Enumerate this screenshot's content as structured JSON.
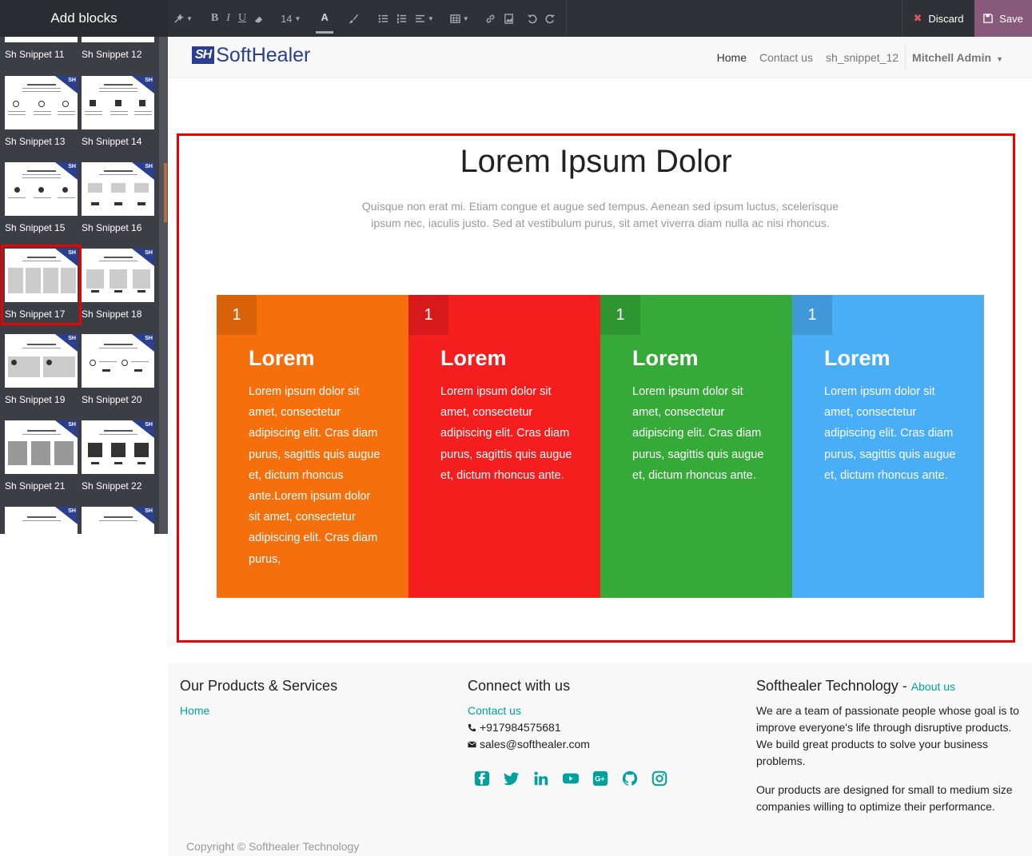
{
  "editor": {
    "panel_title": "Add blocks",
    "font_size": "14",
    "discard_label": "Discard",
    "save_label": "Save",
    "colors": {
      "bar": "#2f3136",
      "save": "#875a7b",
      "discard_icon": "#e0555c"
    }
  },
  "snippets": [
    {
      "label": "Sh Snippet 11"
    },
    {
      "label": "Sh Snippet 12"
    },
    {
      "label": "Sh Snippet 13"
    },
    {
      "label": "Sh Snippet 14"
    },
    {
      "label": "Sh Snippet 15"
    },
    {
      "label": "Sh Snippet 16"
    },
    {
      "label": "Sh Snippet 17"
    },
    {
      "label": "Sh Snippet 18"
    },
    {
      "label": "Sh Snippet 19"
    },
    {
      "label": "Sh Snippet 20"
    },
    {
      "label": "Sh Snippet 21"
    },
    {
      "label": "Sh Snippet 22"
    }
  ],
  "site": {
    "brand_icon": "SH",
    "brand_text": "SoftHealer",
    "nav": {
      "home": "Home",
      "contact": "Contact us",
      "snippet": "sh_snippet_12",
      "user": "Mitchell Admin"
    }
  },
  "section": {
    "title": "Lorem Ipsum Dolor",
    "subtitle": "Quisque non erat mi. Etiam congue et augue sed tempus. Aenean sed ipsum luctus, scelerisque ipsum nec, iaculis justo. Sed at vestibulum purus, sit amet viverra diam nulla ac nisi rhoncus.",
    "cards": [
      {
        "num": "1",
        "title": "Lorem",
        "text": "Lorem ipsum dolor sit amet, consectetur adipiscing elit. Cras diam purus, sagittis quis augue et, dictum rhoncus ante.Lorem ipsum dolor sit amet, consectetur adipiscing elit. Cras diam purus,",
        "color": "#f5700c"
      },
      {
        "num": "1",
        "title": "Lorem",
        "text": "Lorem ipsum dolor sit amet, consectetur adipiscing elit. Cras diam purus, sagittis quis augue et, dictum rhoncus ante.",
        "color": "#f41e1f"
      },
      {
        "num": "1",
        "title": "Lorem",
        "text": "Lorem ipsum dolor sit amet, consectetur adipiscing elit. Cras diam purus, sagittis quis augue et, dictum rhoncus ante.",
        "color": "#35aa38"
      },
      {
        "num": "1",
        "title": "Lorem",
        "text": "Lorem ipsum dolor sit amet, consectetur adipiscing elit. Cras diam purus, sagittis quis augue et, dictum rhoncus ante.",
        "color": "#4aaef7"
      }
    ]
  },
  "footer": {
    "col1_title": "Our Products & Services",
    "col1_link": "Home",
    "col2_title": "Connect with us",
    "col2_link": "Contact us",
    "phone": "+917984575681",
    "email": "sales@softhealer.com",
    "social_icons": [
      "facebook-icon",
      "twitter-icon",
      "linkedin-icon",
      "youtube-icon",
      "google-plus-icon",
      "github-icon",
      "instagram-icon"
    ],
    "col3_title": "Softhealer Technology",
    "col3_dash": " - ",
    "col3_link": "About us",
    "para1": "We are a team of passionate people whose goal is to improve everyone's life through disruptive products. We build great products to solve your business problems.",
    "para2": "Our products are designed for small to medium size companies willing to optimize their performance.",
    "copyright": "Copyright © Softhealer Technology",
    "accent": "#00a09d"
  }
}
